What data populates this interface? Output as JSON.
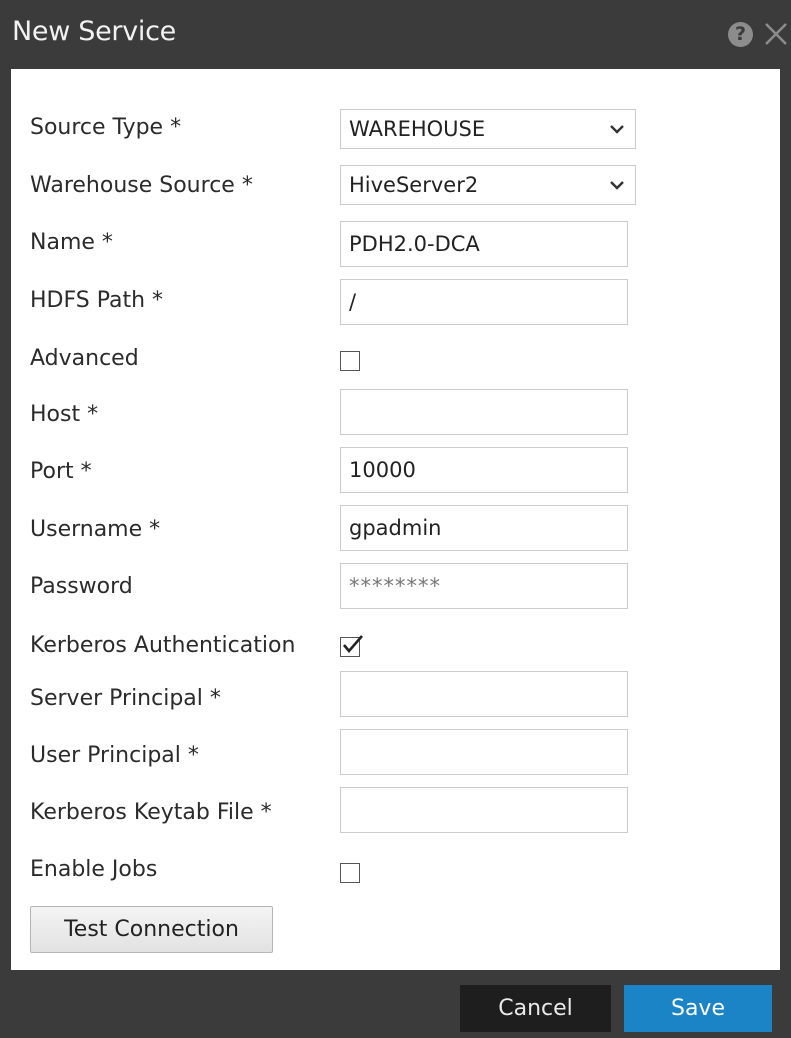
{
  "dialog": {
    "title": "New Service",
    "help_icon": "question-circle-icon",
    "help_glyph": "?",
    "close_icon": "close-icon"
  },
  "form": {
    "source_type": {
      "label": "Source Type *",
      "value": "WAREHOUSE"
    },
    "warehouse_source": {
      "label": "Warehouse Source *",
      "value": "HiveServer2"
    },
    "name": {
      "label": "Name *",
      "value": "PDH2.0-DCA"
    },
    "hdfs_path": {
      "label": "HDFS Path *",
      "value": "/"
    },
    "advanced": {
      "label": "Advanced",
      "checked": false
    },
    "host": {
      "label": "Host *",
      "value": ""
    },
    "port": {
      "label": "Port *",
      "value": "10000"
    },
    "username": {
      "label": "Username *",
      "value": "gpadmin"
    },
    "password": {
      "label": "Password",
      "value": "********"
    },
    "kerberos_auth": {
      "label": "Kerberos Authentication",
      "checked": true
    },
    "server_principal": {
      "label": "Server Principal *",
      "value": ""
    },
    "user_principal": {
      "label": "User Principal *",
      "value": ""
    },
    "kerberos_keytab": {
      "label": "Kerberos Keytab File *",
      "value": ""
    },
    "enable_jobs": {
      "label": "Enable Jobs",
      "checked": false
    },
    "test_connection_label": "Test Connection"
  },
  "footer": {
    "cancel_label": "Cancel",
    "save_label": "Save"
  },
  "colors": {
    "titlebar": "#3b3b3b",
    "save_accent": "#1a84c7",
    "cancel_bg": "#1e1e1e"
  }
}
